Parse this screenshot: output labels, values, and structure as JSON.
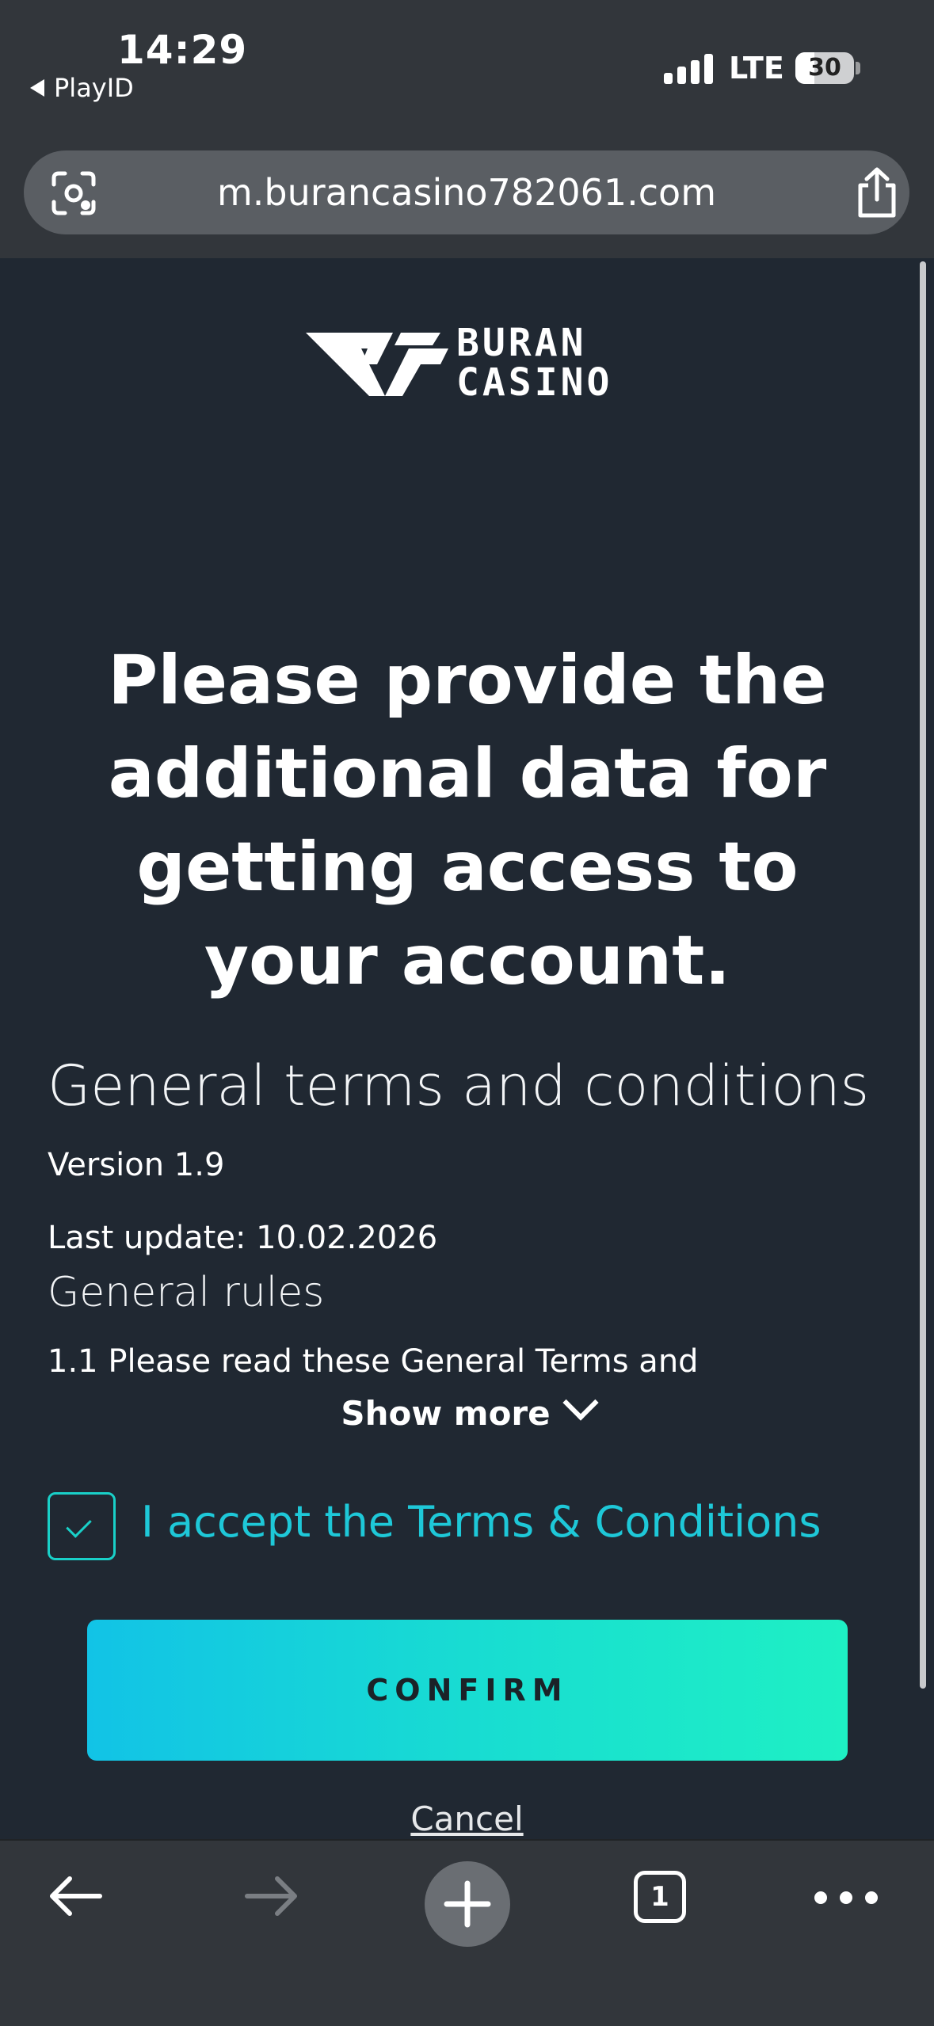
{
  "status_bar": {
    "time": "14:29",
    "back_app": "PlayID",
    "network": "LTE",
    "battery": "30"
  },
  "browser": {
    "url": "m.burancasino782061.com",
    "open_tabs": "1"
  },
  "logo": {
    "line1": "BURAN",
    "line2": "CASINO"
  },
  "page": {
    "headline": "Please provide the additional data for getting access to your account.",
    "terms_title": "General terms and conditions",
    "version": "Version 1.9",
    "last_update": "Last update: 10.02.2026",
    "rules_title": "General rules",
    "rule_1_excerpt": "1.1 Please read these General Terms and",
    "show_more": "Show more",
    "accept_label": "I accept the Terms & Conditions",
    "accept_checked": true,
    "confirm_label": "CONFIRM",
    "cancel_label": "Cancel"
  },
  "colors": {
    "background": "#202832",
    "accent": "#1ec8d8",
    "button_gradient_start": "#12c3e6",
    "button_gradient_end": "#1ef0c4"
  },
  "icons": {
    "url_left": "visual-lookup-icon",
    "url_right": "share-icon",
    "toolbar": [
      "back-arrow-icon",
      "forward-arrow-icon",
      "plus-icon",
      "tabs-icon",
      "more-dots-icon"
    ]
  }
}
